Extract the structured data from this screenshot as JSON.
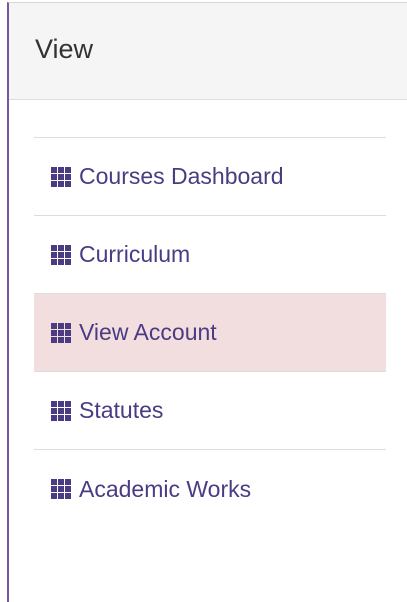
{
  "panel": {
    "title": "View"
  },
  "menu": {
    "items": [
      {
        "label": "Courses Dashboard",
        "icon": "grid-icon",
        "active": false
      },
      {
        "label": "Curriculum",
        "icon": "grid-icon",
        "active": false
      },
      {
        "label": "View Account",
        "icon": "grid-icon",
        "active": true
      },
      {
        "label": "Statutes",
        "icon": "grid-icon",
        "active": false
      },
      {
        "label": "Academic Works",
        "icon": "grid-icon",
        "active": false
      }
    ]
  },
  "colors": {
    "accent": "#4a3b83",
    "active_background": "#f2dede",
    "header_background": "#f5f5f5",
    "panel_border": "#6f5aa3"
  }
}
